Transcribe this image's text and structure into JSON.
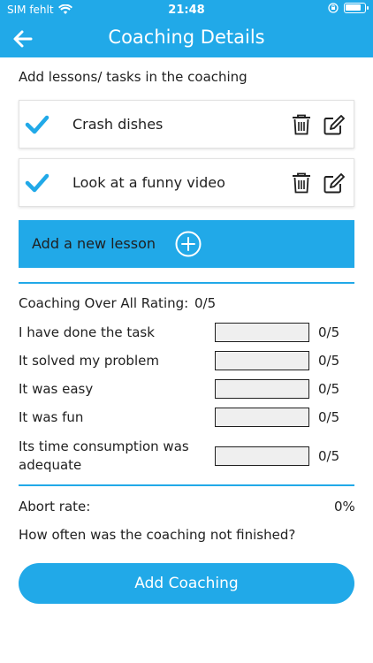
{
  "status_bar": {
    "carrier": "SIM fehlt",
    "time": "21:48",
    "battery_level": 0.85
  },
  "header": {
    "title": "Coaching Details"
  },
  "lessons_section": {
    "title": "Add lessons/ tasks in the coaching"
  },
  "lessons": [
    {
      "label": "Crash dishes"
    },
    {
      "label": "Look at a funny video"
    }
  ],
  "add_lesson": {
    "label": "Add a new lesson"
  },
  "overall_rating": {
    "label": "Coaching Over All Rating:",
    "value": "0/5"
  },
  "ratings": [
    {
      "label": "I have done the task",
      "value": "0/5"
    },
    {
      "label": "It solved my problem",
      "value": "0/5"
    },
    {
      "label": "It was easy",
      "value": "0/5"
    },
    {
      "label": "It was fun",
      "value": "0/5"
    },
    {
      "label": "Its time consumption was adequate",
      "value": "0/5"
    }
  ],
  "abort": {
    "label": "Abort rate:",
    "value": "0%",
    "question": "How often was the coaching not finished?"
  },
  "footer": {
    "button_label": "Add Coaching"
  },
  "colors": {
    "accent": "#21a9e8",
    "text": "#1f1f1f",
    "field_bg": "#efefef"
  }
}
